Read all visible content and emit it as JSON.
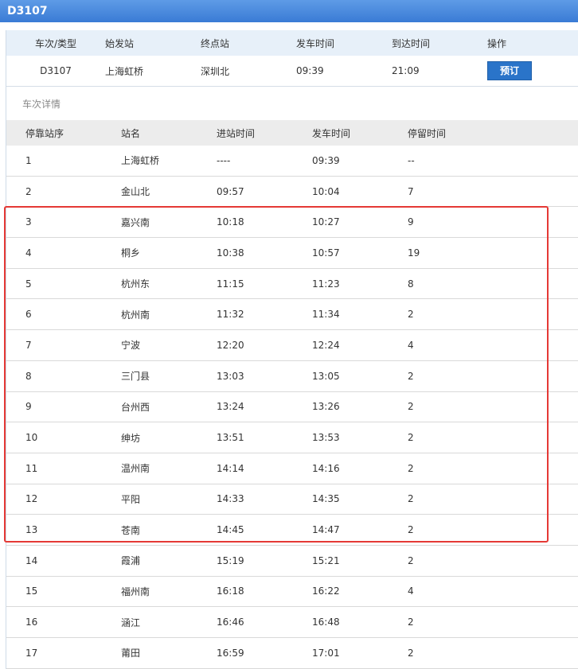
{
  "window": {
    "title": "D3107"
  },
  "summary": {
    "headers": [
      "车次/类型",
      "始发站",
      "终点站",
      "发车时间",
      "到达时间",
      "操作"
    ],
    "train_no": "D3107",
    "origin": "上海虹桥",
    "destination": "深圳北",
    "depart": "09:39",
    "arrive": "21:09",
    "book_label": "预订"
  },
  "details": {
    "section_label": "车次详情",
    "headers": [
      "停靠站序",
      "站名",
      "进站时间",
      "发车时间",
      "停留时间"
    ],
    "rows": [
      [
        "1",
        "上海虹桥",
        "----",
        "09:39",
        "--"
      ],
      [
        "2",
        "金山北",
        "09:57",
        "10:04",
        "7"
      ],
      [
        "3",
        "嘉兴南",
        "10:18",
        "10:27",
        "9"
      ],
      [
        "4",
        "桐乡",
        "10:38",
        "10:57",
        "19"
      ],
      [
        "5",
        "杭州东",
        "11:15",
        "11:23",
        "8"
      ],
      [
        "6",
        "杭州南",
        "11:32",
        "11:34",
        "2"
      ],
      [
        "7",
        "宁波",
        "12:20",
        "12:24",
        "4"
      ],
      [
        "8",
        "三门县",
        "13:03",
        "13:05",
        "2"
      ],
      [
        "9",
        "台州西",
        "13:24",
        "13:26",
        "2"
      ],
      [
        "10",
        "绅坊",
        "13:51",
        "13:53",
        "2"
      ],
      [
        "11",
        "温州南",
        "14:14",
        "14:16",
        "2"
      ],
      [
        "12",
        "平阳",
        "14:33",
        "14:35",
        "2"
      ],
      [
        "13",
        "苍南",
        "14:45",
        "14:47",
        "2"
      ],
      [
        "14",
        "霞浦",
        "15:19",
        "15:21",
        "2"
      ],
      [
        "15",
        "福州南",
        "16:18",
        "16:22",
        "4"
      ],
      [
        "16",
        "涵江",
        "16:46",
        "16:48",
        "2"
      ],
      [
        "17",
        "莆田",
        "16:59",
        "17:01",
        "2"
      ]
    ]
  },
  "colors": {
    "title_bar": "#3a7bd5",
    "book_button": "#2a74c9",
    "highlight_border": "#e53935"
  }
}
